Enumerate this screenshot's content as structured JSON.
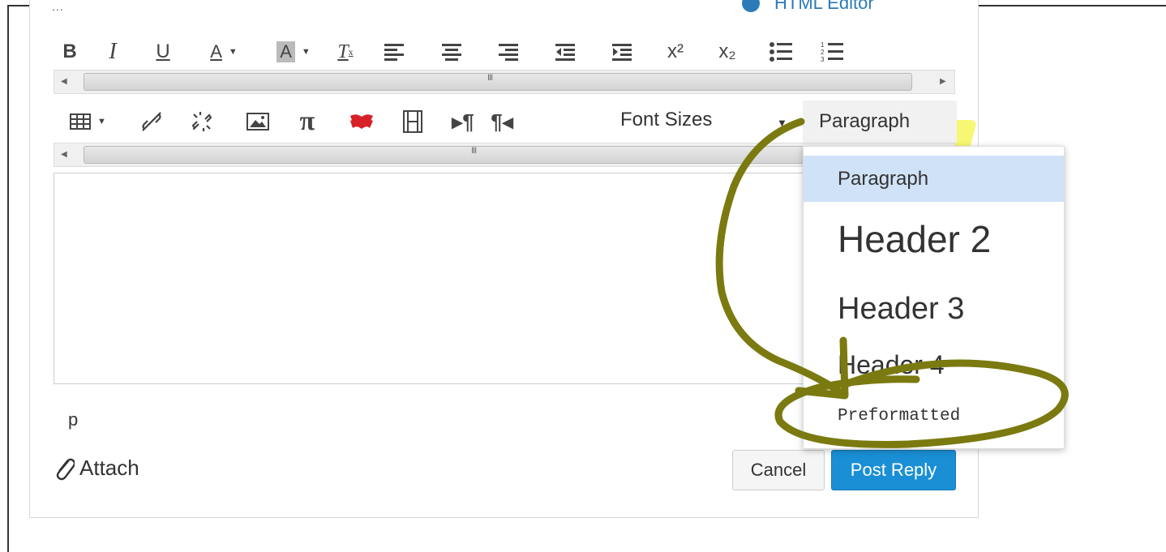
{
  "header": {
    "dots": "...",
    "html_editor_label": "HTML Editor"
  },
  "toolbar1": {
    "buttons": [
      "bold",
      "italic",
      "underline",
      "text-color",
      "background-color",
      "clear-formatting",
      "align-left",
      "align-center",
      "align-right",
      "outdent",
      "indent",
      "superscript",
      "subscript",
      "bullet-list",
      "numbered-list"
    ],
    "bold": "B",
    "italic": "I",
    "underline": "U",
    "text_color": "A",
    "bg_color": "A",
    "clear": "T",
    "superscript": "x²",
    "subscript": "x₂"
  },
  "toolbar2": {
    "font_sizes_label": "Font Sizes",
    "paragraph_label": "Paragraph",
    "pi": "π"
  },
  "dropdown": {
    "items": [
      {
        "label": "Paragraph",
        "selected": true
      },
      {
        "label": "Header 2"
      },
      {
        "label": "Header 3"
      },
      {
        "label": "Header 4"
      },
      {
        "label": "Preformatted"
      }
    ]
  },
  "statusbar": {
    "path": "p"
  },
  "footer": {
    "attach_label": "Attach",
    "cancel_label": "Cancel",
    "post_label": "Post Reply"
  },
  "colors": {
    "accent": "#1a8fd6",
    "annotation": "#7a7a10",
    "highlight": "#f0f000",
    "selected_item": "#cfe2f7"
  },
  "scrollbar_grip": "III"
}
